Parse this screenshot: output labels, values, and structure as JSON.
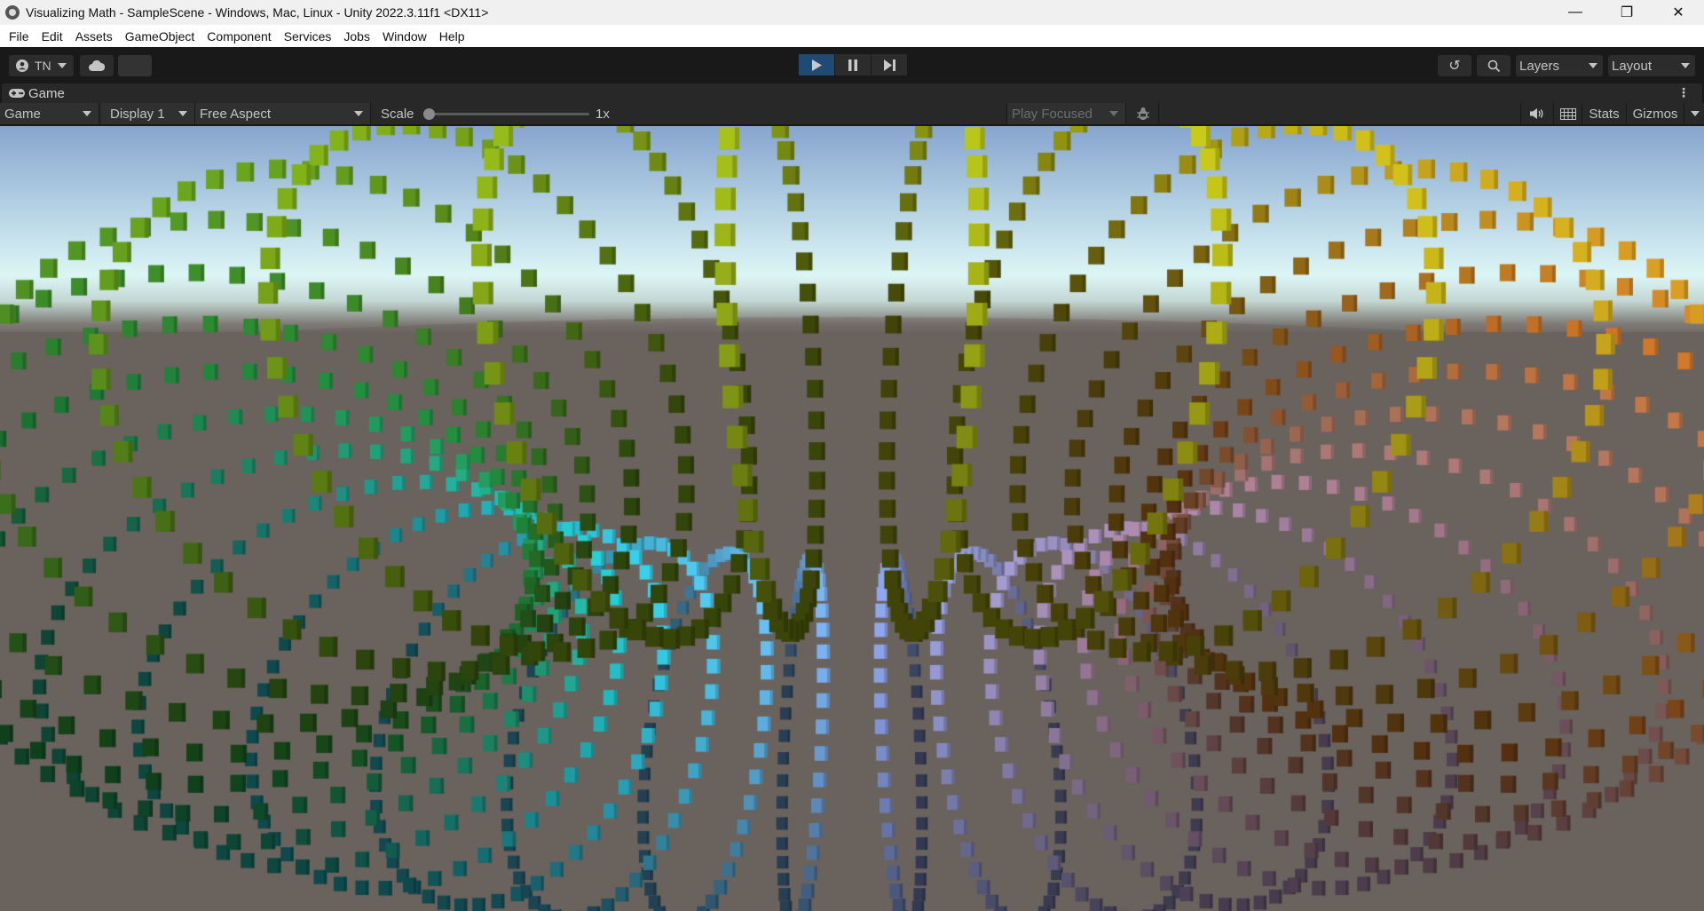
{
  "window": {
    "title": "Visualizing Math - SampleScene - Windows, Mac, Linux - Unity 2022.3.11f1 <DX11>",
    "controls": {
      "minimize": "—",
      "restore": "❐",
      "close": "✕"
    }
  },
  "menu": [
    "File",
    "Edit",
    "Assets",
    "GameObject",
    "Component",
    "Services",
    "Jobs",
    "Window",
    "Help"
  ],
  "toolbar": {
    "account_label": "TN",
    "account_icon": "user-circle-icon",
    "cloud_icon": "cloud-icon",
    "play_controls": [
      {
        "name": "play",
        "glyph": "▶",
        "active": true
      },
      {
        "name": "pause",
        "glyph": "❚❚",
        "active": false
      },
      {
        "name": "step",
        "glyph": "▶❙",
        "active": false
      }
    ],
    "history_icon": "↺",
    "search_icon": "⚲",
    "layers_label": "Layers",
    "layout_label": "Layout"
  },
  "tab": {
    "label": "Game",
    "icon": "gamepad-icon",
    "menu_glyph": "⋮"
  },
  "game_toolbar": {
    "view_select": "Game",
    "display_select": "Display 1",
    "aspect_select": "Free Aspect",
    "scale_label": "Scale",
    "scale_value": "1x",
    "scale_slider_fraction": 0.0,
    "play_mode_select": "Play Focused",
    "mute_icon": "🔈",
    "stats_label": "Stats",
    "gizmos_label": "Gizmos"
  },
  "scene": {
    "sky_colors": {
      "top": "#87a6cf",
      "horizon": "#dcf6f6",
      "ground": "#6a625d"
    },
    "object": "torus of cubes",
    "major_rings": 32,
    "cubes_per_ring": 48,
    "hue_gradient": [
      "#29d6e8",
      "#2db84a",
      "#8fc61e",
      "#c8c418",
      "#f08a2e",
      "#e6b0d8",
      "#8fa8f0"
    ]
  }
}
